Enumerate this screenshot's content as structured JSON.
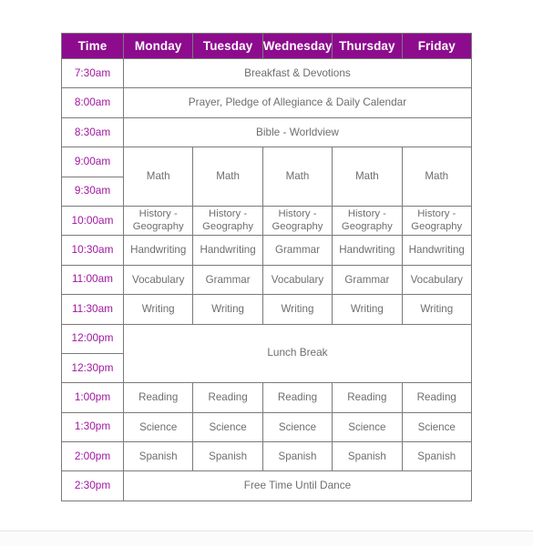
{
  "table": {
    "columns": [
      "Time",
      "Monday",
      "Tuesday",
      "Wednesday",
      "Thursday",
      "Friday"
    ],
    "header_bg": "#8d0b8d",
    "header_text_color": "#ffffff",
    "time_text_color": "#a018a0",
    "body_text_color": "#6e6e6e",
    "border_color": "#7a7a7a",
    "page_bg": "#fbfbfb",
    "rows": [
      {
        "time": "7:30am",
        "span": true,
        "activity": "Breakfast & Devotions"
      },
      {
        "time": "8:00am",
        "span": true,
        "activity": "Prayer, Pledge of Allegiance & Daily Calendar"
      },
      {
        "time": "8:30am",
        "span": true,
        "activity": "Bible - Worldview"
      },
      {
        "time": "9:00am",
        "span": false,
        "rowspan_start": true,
        "cells": [
          "Math",
          "Math",
          "Math",
          "Math",
          "Math"
        ]
      },
      {
        "time": "9:30am",
        "span": false,
        "rowspan_continued": true,
        "cells": []
      },
      {
        "time": "10:00am",
        "span": false,
        "cells": [
          "History - Geography",
          "History - Geography",
          "History - Geography",
          "History - Geography",
          "History - Geography"
        ]
      },
      {
        "time": "10:30am",
        "span": false,
        "cells": [
          "Handwriting",
          "Handwriting",
          "Grammar",
          "Handwriting",
          "Handwriting"
        ]
      },
      {
        "time": "11:00am",
        "span": false,
        "cells": [
          "Vocabulary",
          "Grammar",
          "Vocabulary",
          "Grammar",
          "Vocabulary"
        ]
      },
      {
        "time": "11:30am",
        "span": false,
        "cells": [
          "Writing",
          "Writing",
          "Writing",
          "Writing",
          "Writing"
        ]
      },
      {
        "time": "12:00pm",
        "span": true,
        "rowspan_start": true,
        "activity": "Lunch Break"
      },
      {
        "time": "12:30pm",
        "span": true,
        "rowspan_continued": true,
        "activity": ""
      },
      {
        "time": "1:00pm",
        "span": false,
        "cells": [
          "Reading",
          "Reading",
          "Reading",
          "Reading",
          "Reading"
        ]
      },
      {
        "time": "1:30pm",
        "span": false,
        "cells": [
          "Science",
          "Science",
          "Science",
          "Science",
          "Science"
        ]
      },
      {
        "time": "2:00pm",
        "span": false,
        "cells": [
          "Spanish",
          "Spanish",
          "Spanish",
          "Spanish",
          "Spanish"
        ]
      },
      {
        "time": "2:30pm",
        "span": true,
        "activity": "Free Time Until Dance"
      }
    ]
  }
}
